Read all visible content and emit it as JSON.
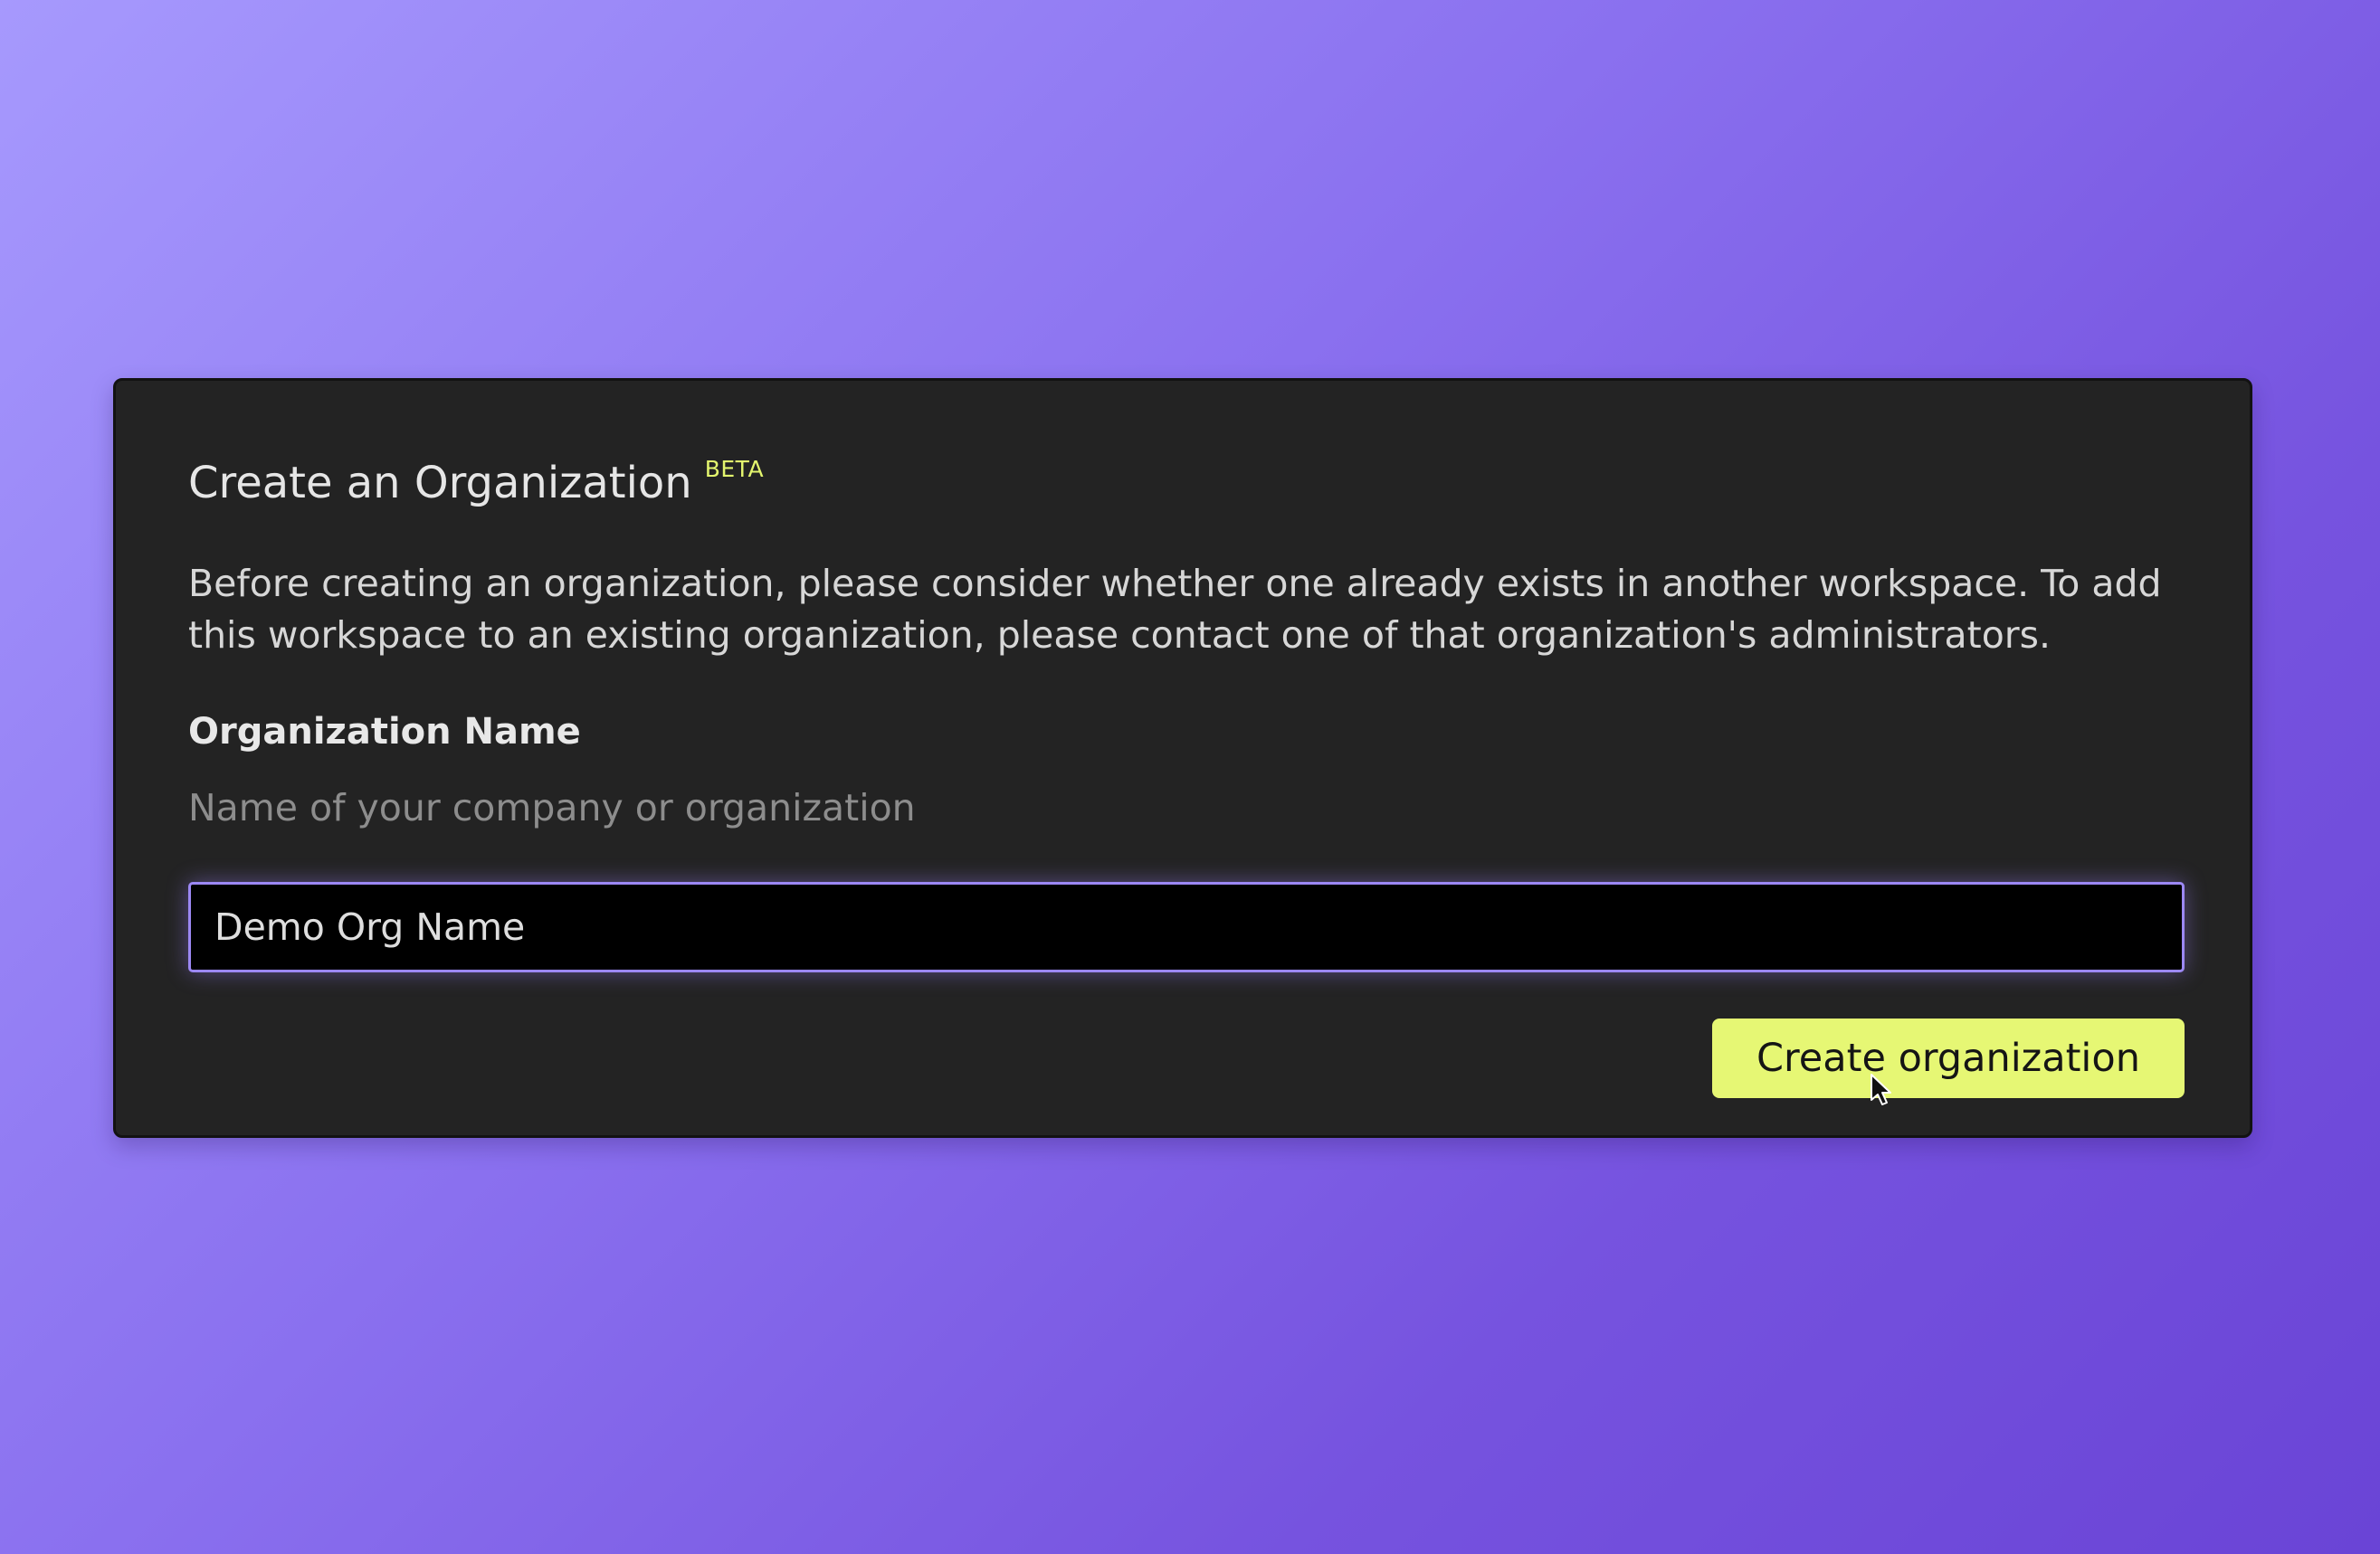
{
  "dialog": {
    "title": "Create an Organization",
    "badge": "BETA",
    "description": "Before creating an organization, please consider whether one already exists in another workspace. To add this workspace to an existing organization, please contact one of that organization's administrators."
  },
  "form": {
    "org_name_label": "Organization Name",
    "org_name_hint": "Name of your company or organization",
    "org_name_value": "Demo Org Name",
    "submit_label": "Create organization"
  },
  "colors": {
    "accent": "#e6f774",
    "input_focus_border": "#9c88f4",
    "card_background": "#232323"
  },
  "icons": {
    "cursor": "mouse-pointer-icon"
  }
}
